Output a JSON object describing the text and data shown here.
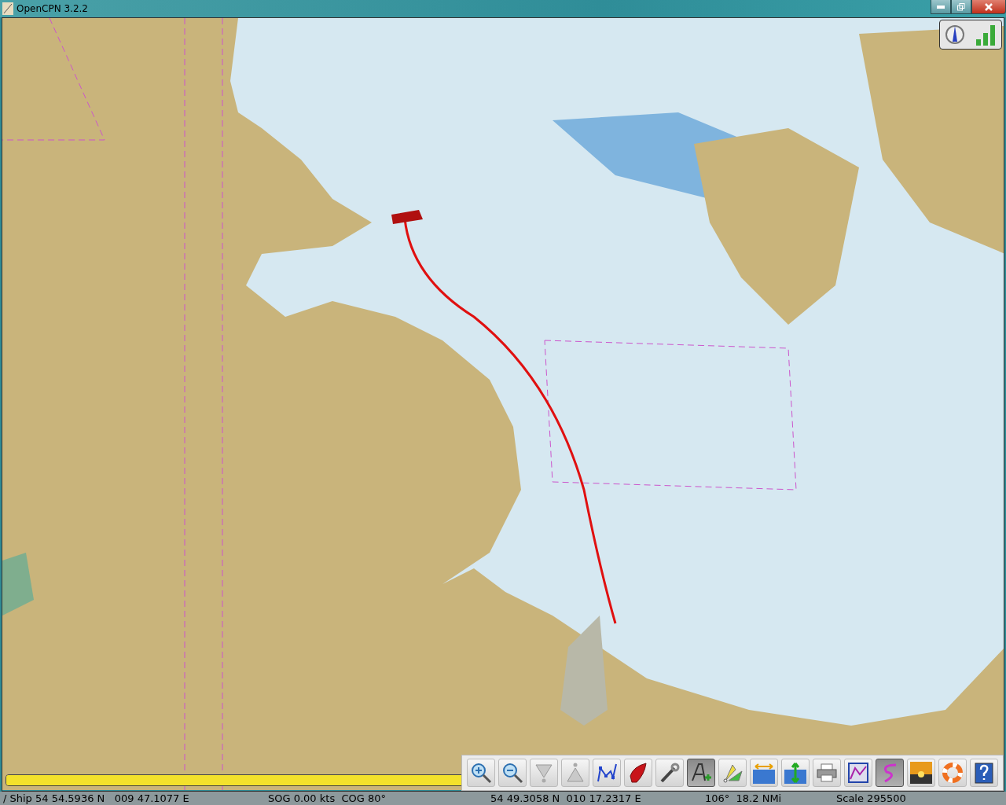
{
  "window": {
    "title": "OpenCPN 3.2.2"
  },
  "toolbar": [
    {
      "kind": "zoom-in",
      "selected": false
    },
    {
      "kind": "zoom-out",
      "selected": false
    },
    {
      "kind": "scale-down",
      "selected": false
    },
    {
      "kind": "scale-up",
      "selected": false
    },
    {
      "kind": "route",
      "selected": false
    },
    {
      "kind": "ship",
      "selected": false
    },
    {
      "kind": "settings",
      "selected": false
    },
    {
      "kind": "text",
      "selected": true
    },
    {
      "kind": "mark",
      "selected": false
    },
    {
      "kind": "current",
      "selected": false
    },
    {
      "kind": "tide",
      "selected": false
    },
    {
      "kind": "print",
      "selected": false
    },
    {
      "kind": "route-manager",
      "selected": false
    },
    {
      "kind": "track",
      "selected": true
    },
    {
      "kind": "sunset",
      "selected": false
    },
    {
      "kind": "lifebuoy",
      "selected": false
    },
    {
      "kind": "help",
      "selected": false
    }
  ],
  "progress": {
    "level": 1
  },
  "status_bar": [
    "/ Ship 54 54.5936 N   009 47.1077 E",
    "SOG 0.00 kts  COG 80°",
    "54 49.3058 N  010 17.2317 E",
    "106°  18.2 NMi",
    "Scale 295500"
  ]
}
